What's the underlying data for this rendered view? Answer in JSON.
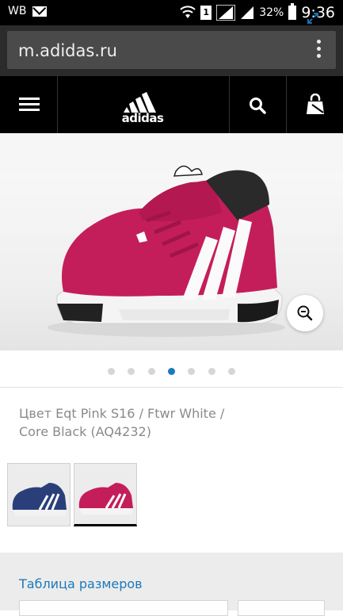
{
  "status_bar": {
    "carrier": "WB",
    "sim_slot": "1",
    "battery": "32%",
    "time": "9:36"
  },
  "browser": {
    "url": "m.adidas.ru"
  },
  "nav": {
    "logo_text": "adidas",
    "menu_icon": "hamburger-icon",
    "search_icon": "search-icon",
    "bag_icon": "shopping-bag-icon"
  },
  "gallery": {
    "total_slides": 7,
    "active_slide": 4,
    "accent_color": "#1a7abc"
  },
  "product": {
    "color_description": "Цвет Eqt Pink S16 / Ftwr White / Core Black (AQ4232)"
  },
  "swatches": [
    {
      "color": "navy-blue"
    },
    {
      "color": "pink",
      "selected": true
    }
  ],
  "size_section": {
    "size_table_link": "Таблица размеров"
  }
}
